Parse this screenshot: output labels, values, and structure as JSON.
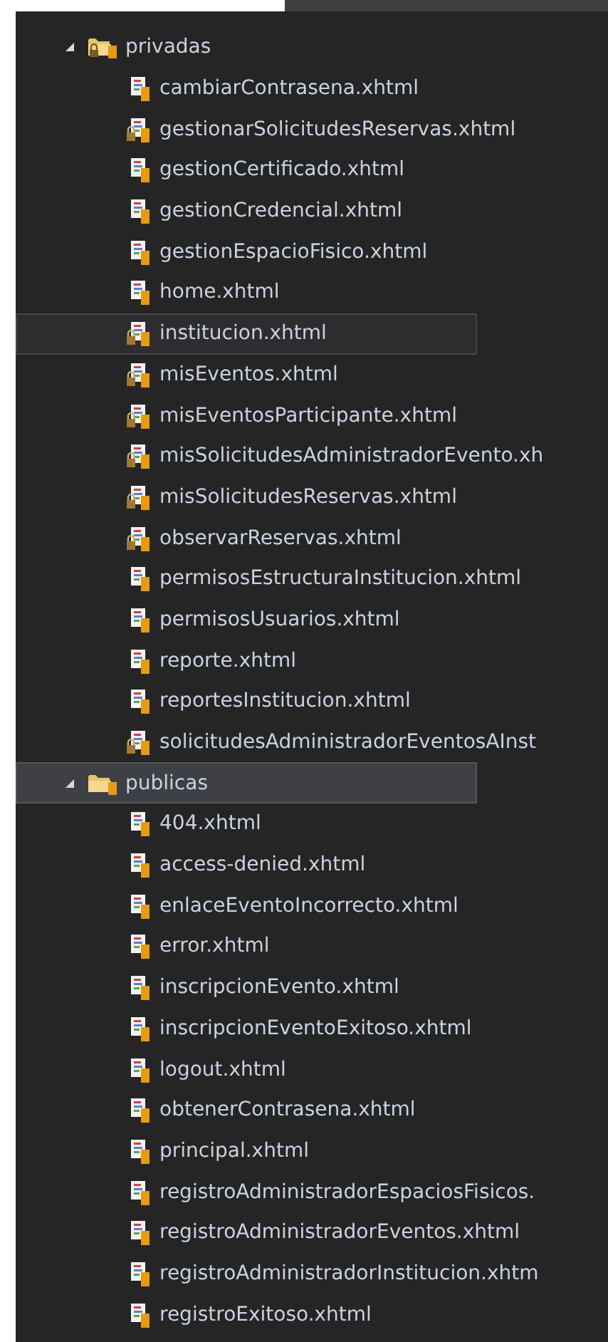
{
  "tree": [
    {
      "name": "privadas",
      "expanded": true,
      "selected": false,
      "hovered": false,
      "children": [
        {
          "name": "cambiarContrasena.xhtml",
          "kind": "page",
          "selected": false,
          "hovered": false
        },
        {
          "name": "gestionarSolicitudesReservas.xhtml",
          "kind": "locked",
          "selected": false,
          "hovered": false
        },
        {
          "name": "gestionCertificado.xhtml",
          "kind": "page",
          "selected": false,
          "hovered": false
        },
        {
          "name": "gestionCredencial.xhtml",
          "kind": "page",
          "selected": false,
          "hovered": false
        },
        {
          "name": "gestionEspacioFisico.xhtml",
          "kind": "page",
          "selected": false,
          "hovered": false
        },
        {
          "name": "home.xhtml",
          "kind": "page",
          "selected": false,
          "hovered": false
        },
        {
          "name": "institucion.xhtml",
          "kind": "locked",
          "selected": false,
          "hovered": true
        },
        {
          "name": "misEventos.xhtml",
          "kind": "locked",
          "selected": false,
          "hovered": false
        },
        {
          "name": "misEventosParticipante.xhtml",
          "kind": "locked",
          "selected": false,
          "hovered": false
        },
        {
          "name": "misSolicitudesAdministradorEvento.xh",
          "kind": "locked",
          "selected": false,
          "hovered": false
        },
        {
          "name": "misSolicitudesReservas.xhtml",
          "kind": "locked",
          "selected": false,
          "hovered": false
        },
        {
          "name": "observarReservas.xhtml",
          "kind": "locked",
          "selected": false,
          "hovered": false
        },
        {
          "name": "permisosEstructuraInstitucion.xhtml",
          "kind": "page",
          "selected": false,
          "hovered": false
        },
        {
          "name": "permisosUsuarios.xhtml",
          "kind": "page",
          "selected": false,
          "hovered": false
        },
        {
          "name": "reporte.xhtml",
          "kind": "page",
          "selected": false,
          "hovered": false
        },
        {
          "name": "reportesInstitucion.xhtml",
          "kind": "page",
          "selected": false,
          "hovered": false
        },
        {
          "name": "solicitudesAdministradorEventosAInst",
          "kind": "locked",
          "selected": false,
          "hovered": false
        }
      ]
    },
    {
      "name": "publicas",
      "expanded": true,
      "selected": true,
      "hovered": false,
      "children": [
        {
          "name": "404.xhtml",
          "kind": "page",
          "selected": false,
          "hovered": false
        },
        {
          "name": "access-denied.xhtml",
          "kind": "page",
          "selected": false,
          "hovered": false
        },
        {
          "name": "enlaceEventoIncorrecto.xhtml",
          "kind": "page",
          "selected": false,
          "hovered": false
        },
        {
          "name": "error.xhtml",
          "kind": "page",
          "selected": false,
          "hovered": false
        },
        {
          "name": "inscripcionEvento.xhtml",
          "kind": "page",
          "selected": false,
          "hovered": false
        },
        {
          "name": "inscripcionEventoExitoso.xhtml",
          "kind": "page",
          "selected": false,
          "hovered": false
        },
        {
          "name": "logout.xhtml",
          "kind": "page",
          "selected": false,
          "hovered": false
        },
        {
          "name": "obtenerContrasena.xhtml",
          "kind": "page",
          "selected": false,
          "hovered": false
        },
        {
          "name": "principal.xhtml",
          "kind": "page",
          "selected": false,
          "hovered": false
        },
        {
          "name": "registroAdministradorEspaciosFisicos.",
          "kind": "page",
          "selected": false,
          "hovered": false
        },
        {
          "name": "registroAdministradorEventos.xhtml",
          "kind": "page",
          "selected": false,
          "hovered": false
        },
        {
          "name": "registroAdministradorInstitucion.xhtm",
          "kind": "page",
          "selected": false,
          "hovered": false
        },
        {
          "name": "registroExitoso.xhtml",
          "kind": "page",
          "selected": false,
          "hovered": false
        }
      ]
    }
  ]
}
